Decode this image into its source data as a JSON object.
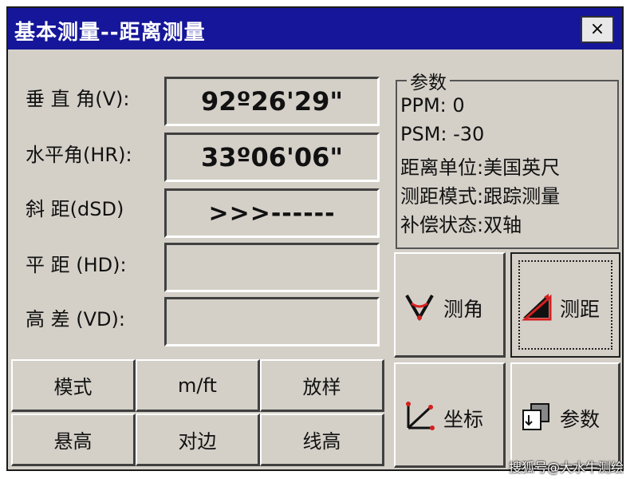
{
  "window": {
    "title": "基本测量--距离测量",
    "close_label": "×"
  },
  "measurements": [
    {
      "label": "垂 直 角(V):",
      "value": "92º26'29\""
    },
    {
      "label": "水平角(HR):",
      "value": "33º06'06\""
    },
    {
      "label": "斜  距(dSD)",
      "value": ">>>------"
    },
    {
      "label": "平  距 (HD):",
      "value": ""
    },
    {
      "label": "高  差 (VD):",
      "value": ""
    }
  ],
  "params": {
    "title": "参数",
    "ppm": "PPM:   0",
    "psm": "PSM: -30",
    "unit": "距离单位:美国英尺",
    "mode": "测距模式:跟踪测量",
    "compensation": "补偿状态:双轴"
  },
  "buttons": {
    "mode": "模式",
    "unit_toggle": "m/ft",
    "stakeout": "放样",
    "height_remote": "悬高",
    "opposite_side": "对边",
    "line_height": "线高",
    "measure_angle": "测角",
    "measure_distance": "测距",
    "coordinates": "坐标",
    "parameters": "参数"
  },
  "icons": {
    "measure_angle": "angle-v-icon",
    "measure_distance": "distance-triangle-icon",
    "coordinates": "axes-coordinate-icon",
    "parameters": "settings-doc-icon"
  },
  "watermark": "搜狐号@大水牛测绘",
  "colors": {
    "titlebar": "#16169a",
    "panel": "#d4d0c8",
    "accent_red": "#d42020"
  }
}
